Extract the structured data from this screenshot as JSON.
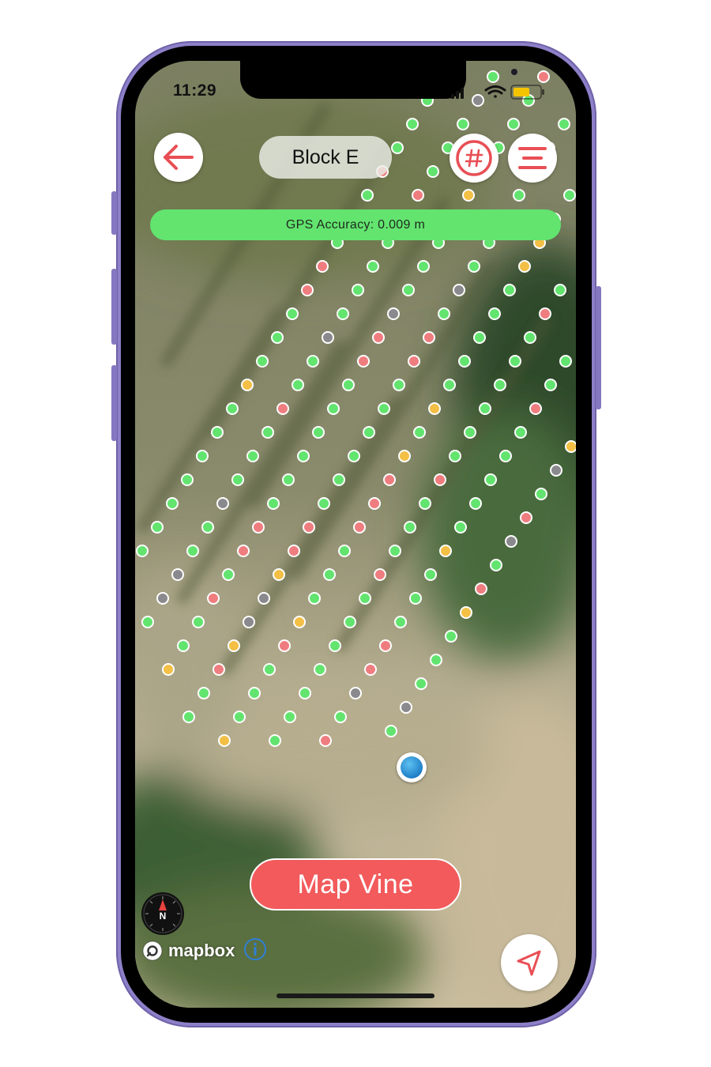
{
  "status_bar": {
    "time": "11:29",
    "icons": [
      "location-arrow-icon",
      "signal-icon",
      "wifi-icon",
      "battery-icon"
    ],
    "battery_color": "#f5c400"
  },
  "header": {
    "back_icon": "arrow-left-icon",
    "block_name": "Block E",
    "row_number_icon": "hash-icon",
    "menu_icon": "menu-icon",
    "accent_color": "#e84f55"
  },
  "gps": {
    "text": "GPS Accuracy: 0.009 m",
    "color": "#62e46f"
  },
  "map": {
    "legend_colors": {
      "green": "#62e46f",
      "red": "#ef7d7f",
      "yellow": "#f3bf45",
      "gray": "#8a8a8e"
    },
    "user_location_icon": "user-location-dot-icon"
  },
  "actions": {
    "map_vine_label": "Map Vine",
    "locate_icon": "navigation-arrow-icon"
  },
  "attribution": {
    "logo_text": "mapbox",
    "compass_letter": "N",
    "info_icon": "info-icon"
  }
}
